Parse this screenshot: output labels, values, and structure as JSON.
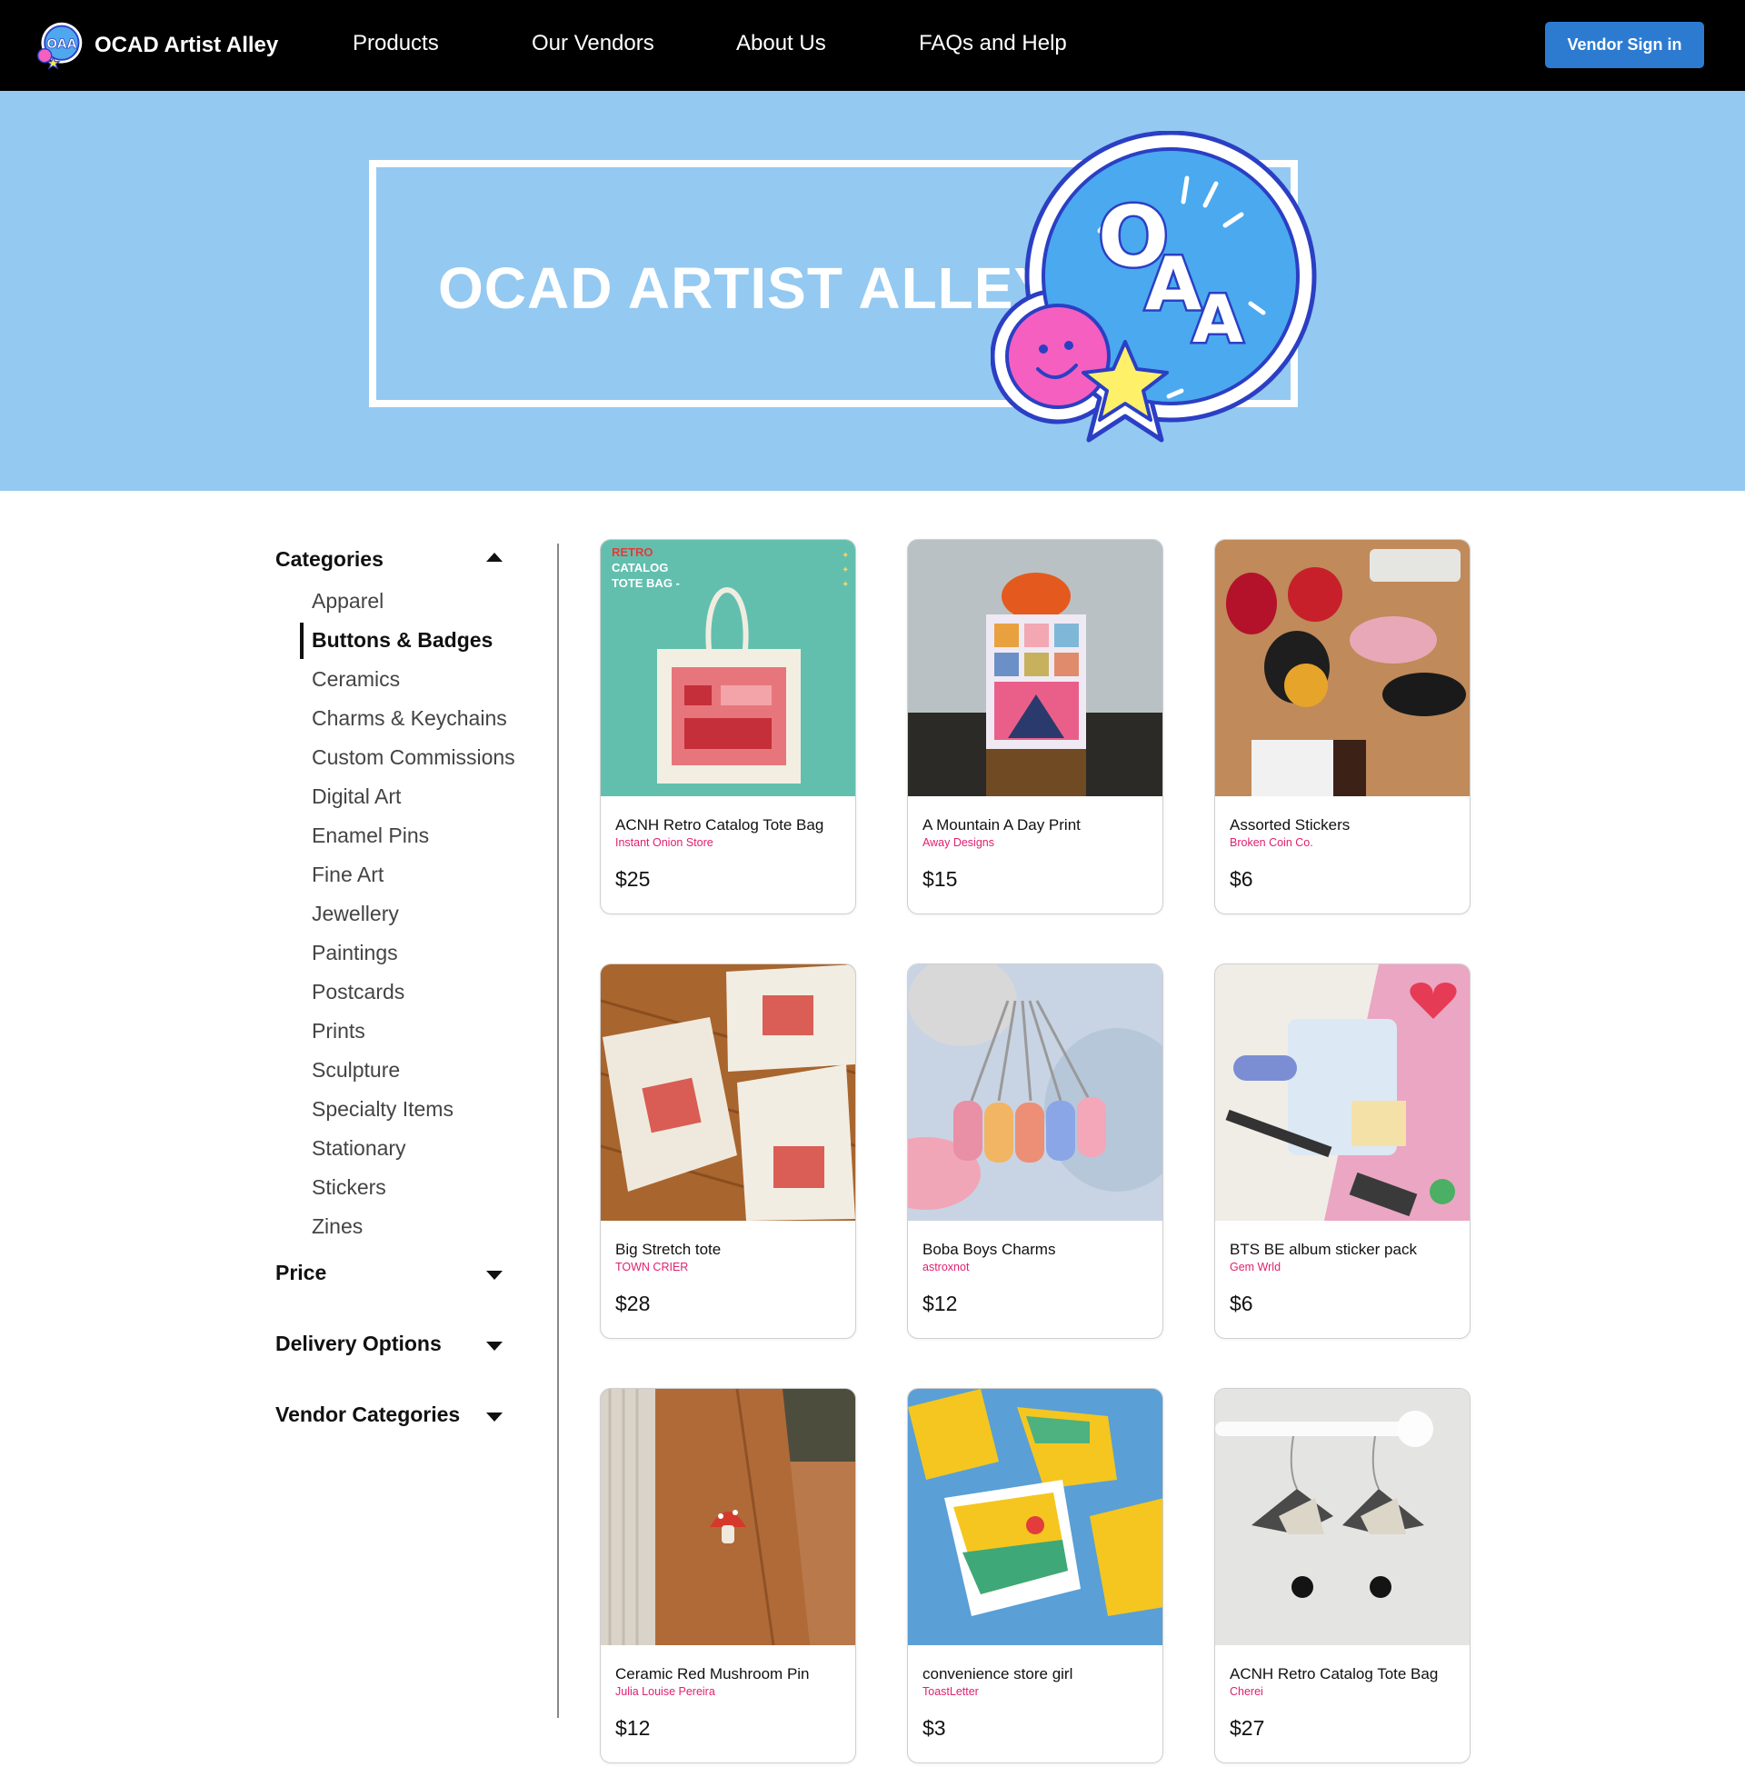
{
  "nav": {
    "brand": "OCAD Artist Alley",
    "links": [
      "Products",
      "Our Vendors",
      "About Us",
      "FAQs and Help"
    ],
    "vendor_button": "Vendor Sign in"
  },
  "hero": {
    "title": "OCAD ARTIST ALLEY",
    "logo_text": "OAA"
  },
  "sidebar": {
    "categories_heading": "Categories",
    "categories": [
      "Apparel",
      "Buttons & Badges",
      "Ceramics",
      "Charms & Keychains",
      "Custom Commissions",
      "Digital Art",
      "Enamel Pins",
      "Fine Art",
      "Jewellery",
      "Paintings",
      "Postcards",
      "Prints",
      "Sculpture",
      "Specialty Items",
      "Stationary",
      "Stickers",
      "Zines"
    ],
    "active_category": "Buttons & Badges",
    "price_heading": "Price",
    "delivery_heading": "Delivery Options",
    "vendor_categories_heading": "Vendor Categories"
  },
  "products": [
    {
      "title": "ACNH Retro Catalog Tote Bag",
      "vendor": "Instant Onion Store",
      "price": "$25",
      "image_text": [
        "RETRO",
        "CATALOG",
        "TOTE BAG -"
      ]
    },
    {
      "title": "A Mountain A Day Print",
      "vendor": "Away Designs",
      "price": "$15"
    },
    {
      "title": "Assorted Stickers",
      "vendor": "Broken Coin Co.",
      "price": "$6"
    },
    {
      "title": "Big Stretch tote",
      "vendor": "TOWN CRIER",
      "price": "$28"
    },
    {
      "title": "Boba Boys Charms",
      "vendor": "astroxnot",
      "price": "$12"
    },
    {
      "title": "BTS BE album sticker pack",
      "vendor": "Gem Wrld",
      "price": "$6"
    },
    {
      "title": "Ceramic Red Mushroom Pin",
      "vendor": "Julia Louise Pereira",
      "price": "$12"
    },
    {
      "title": "convenience store girl",
      "vendor": "ToastLetter",
      "price": "$3"
    },
    {
      "title": "ACNH Retro Catalog Tote Bag",
      "vendor": "Cherei",
      "price": "$27"
    }
  ],
  "colors": {
    "nav_bg": "#000000",
    "hero_bg": "#94c9f1",
    "accent_button": "#2c7bd1",
    "vendor_text": "#e0206f"
  }
}
